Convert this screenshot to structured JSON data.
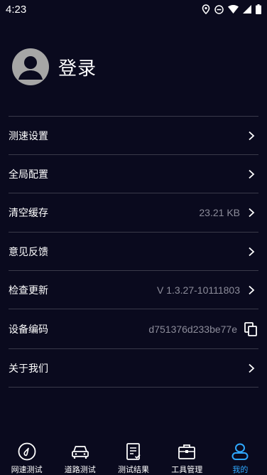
{
  "status_bar": {
    "time": "4:23",
    "icons": [
      "location-icon",
      "do-not-disturb-icon",
      "wifi-icon",
      "signal-icon",
      "battery-icon"
    ]
  },
  "profile": {
    "login_label": "登录",
    "avatar_icon": "user-avatar-icon"
  },
  "menu": {
    "items": [
      {
        "label": "测速设置",
        "value": "",
        "action_icon": "chevron-right-icon"
      },
      {
        "label": "全局配置",
        "value": "",
        "action_icon": "chevron-right-icon"
      },
      {
        "label": "清空缓存",
        "value": "23.21 KB",
        "action_icon": "chevron-right-icon"
      },
      {
        "label": "意见反馈",
        "value": "",
        "action_icon": "chevron-right-icon"
      },
      {
        "label": "检查更新",
        "value": "V 1.3.27-10111803",
        "action_icon": "chevron-right-icon"
      },
      {
        "label": "设备编码",
        "value": "d751376d233be77e",
        "action_icon": "copy-icon"
      },
      {
        "label": "关于我们",
        "value": "",
        "action_icon": "chevron-right-icon"
      }
    ]
  },
  "tabbar": {
    "tabs": [
      {
        "label": "网速测试",
        "icon": "speed-test-icon",
        "active": false
      },
      {
        "label": "道路测试",
        "icon": "car-icon",
        "active": false
      },
      {
        "label": "测试结果",
        "icon": "results-list-icon",
        "active": false
      },
      {
        "label": "工具管理",
        "icon": "toolbox-icon",
        "active": false
      },
      {
        "label": "我的",
        "icon": "user-profile-icon",
        "active": true
      }
    ]
  },
  "colors": {
    "background": "#0a0a1e",
    "divider": "#3a3a4a",
    "secondary_text": "#8c8c9a",
    "accent": "#2fa8ff",
    "avatar": "#a6a6a6"
  }
}
